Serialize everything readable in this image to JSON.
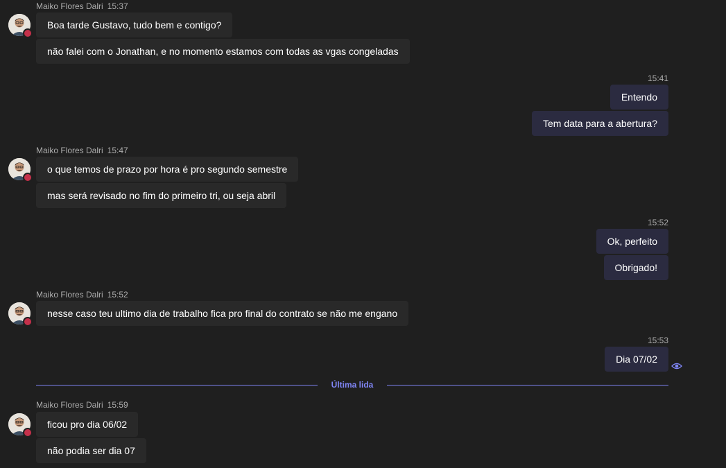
{
  "colors": {
    "background": "#1f1f1f",
    "incoming_bubble": "#292929",
    "outgoing_bubble": "#2b2b40",
    "accent": "#7f85f5",
    "presence_busy": "#c4314b"
  },
  "groups": [
    {
      "sender": "Maiko Flores Dalri",
      "time": "15:37",
      "messages": [
        "Boa tarde Gustavo, tudo bem e contigo?",
        "não falei com o Jonathan, e no momento estamos com todas as vgas congeladas"
      ]
    },
    {
      "time": "15:41",
      "messages": [
        "Entendo",
        "Tem data para a abertura?"
      ]
    },
    {
      "sender": "Maiko Flores Dalri",
      "time": "15:47",
      "messages": [
        "o que temos de prazo por hora é pro segundo semestre",
        "mas será revisado no fim do primeiro tri, ou seja abril"
      ]
    },
    {
      "time": "15:52",
      "messages": [
        "Ok, perfeito",
        "Obrigado!"
      ]
    },
    {
      "sender": "Maiko Flores Dalri",
      "time": "15:52",
      "messages": [
        "nesse caso teu ultimo dia de trabalho fica pro final do contrato se não me engano"
      ]
    },
    {
      "time": "15:53",
      "messages": [
        "Dia 07/02"
      ]
    },
    {
      "sender": "Maiko Flores Dalri",
      "time": "15:59",
      "messages": [
        "ficou pro dia 06/02",
        "não podia ser dia 07"
      ]
    }
  ],
  "divider": {
    "label": "Última lida"
  },
  "icons": {
    "read_receipt": "eye-icon",
    "presence": "busy-status-icon"
  }
}
